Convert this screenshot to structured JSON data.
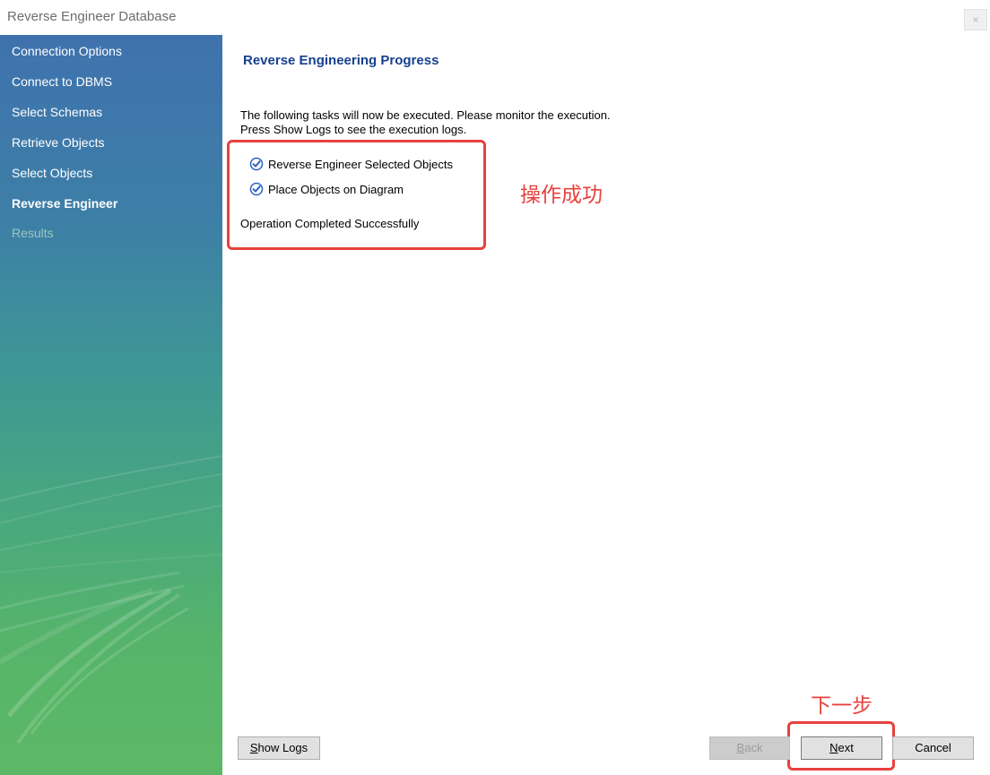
{
  "window": {
    "title": "Reverse Engineer Database",
    "close_glyph": "×"
  },
  "sidebar": {
    "items": [
      {
        "label": "Connection Options",
        "state": "completed"
      },
      {
        "label": "Connect to DBMS",
        "state": "completed"
      },
      {
        "label": "Select Schemas",
        "state": "completed"
      },
      {
        "label": "Retrieve Objects",
        "state": "completed"
      },
      {
        "label": "Select Objects",
        "state": "completed"
      },
      {
        "label": "Reverse Engineer",
        "state": "active"
      },
      {
        "label": "Results",
        "state": "disabled"
      }
    ]
  },
  "main": {
    "title": "Reverse Engineering Progress",
    "description_line1": "The following tasks will now be executed. Please monitor the execution.",
    "description_line2": "Press Show Logs to see the execution logs.",
    "tasks": [
      {
        "label": "Reverse Engineer Selected Objects",
        "done": true
      },
      {
        "label": "Place Objects on Diagram",
        "done": true
      }
    ],
    "status": "Operation Completed Successfully"
  },
  "annotations": {
    "success_note": "操作成功",
    "next_note": "下一步",
    "color": "#e8413e"
  },
  "buttons": {
    "show_logs": {
      "mnemonic": "S",
      "rest": "how Logs"
    },
    "back": {
      "mnemonic": "B",
      "rest": "ack"
    },
    "next": {
      "mnemonic": "N",
      "rest": "ext"
    },
    "cancel": "Cancel"
  },
  "colors": {
    "title_blue": "#16408f",
    "check_blue": "#2a63c4"
  }
}
